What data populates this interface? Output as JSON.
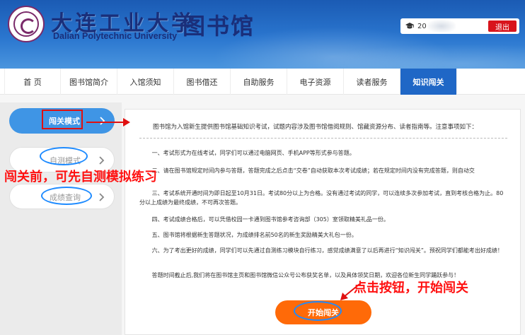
{
  "header": {
    "school_name_cn": "大连工业大学",
    "school_name_en": "Dalian Polytechnic University",
    "library_title": "图书馆",
    "user_id": "20",
    "logout_label": "退出"
  },
  "nav": {
    "items": [
      {
        "label": "首 页"
      },
      {
        "label": "图书馆简介"
      },
      {
        "label": "入馆须知"
      },
      {
        "label": "图书借还"
      },
      {
        "label": "自助服务"
      },
      {
        "label": "电子资源"
      },
      {
        "label": "读者服务"
      },
      {
        "label": "知识闯关"
      }
    ],
    "active": "知识闯关"
  },
  "sidebar": {
    "items": [
      {
        "label": "闯关模式"
      },
      {
        "label": "自测模式"
      },
      {
        "label": "成绩查询"
      }
    ]
  },
  "content": {
    "intro": "图书馆为入馆新生提供图书馆基础知识考试，试题内容涉及图书馆借阅规则、馆藏资源分布、读者指南等。注意事项如下：",
    "rules": [
      "一、考试形式为在线考试，同学们可以通过电脑网页、手机APP等形式参与答题。",
      "二、请在图书馆规定时间内参与答题，答题完成之后点击“交卷”自动获取本次考试成绩；若在规定时间内没有完成答题，则自动交",
      "三、考试系统开通时间为即日起至10月31日。考试80分以上为合格。没有通过考试的同学，可以连续多次参加考试，直到考核合格为止。80分以上成绩为最终成绩，不可再次答题。",
      "四、考试成绩合格后，可以凭借校园一卡通到图书馆参考咨询部（305）室领取精美礼品一份。",
      "五、图书馆将根据新生答题状况，为成绩排名前50名的新生奖励精美大礼包一份。",
      "六、为了考出更好的成绩，同学们可以先通过自测练习模块自行练习，感觉成绩满意了以后再进行“知识闯关”。预祝同学们都能考出好成绩！",
      "答题时间截止后,我们将在图书馆主页和图书馆微信公众号公布获奖名单，以及具体领奖日期，欢迎各位新生同学踊跃参与！"
    ],
    "start_button": "开始闯关"
  },
  "annotations": {
    "left_note": "闯关前，可先自测模拟练习",
    "bottom_note": "点击按钮，开始闯关"
  },
  "colors": {
    "header_blue": "#2a76cf",
    "nav_active": "#1f67c6",
    "side_active": "#3f95e5",
    "start_button": "#ff6a08",
    "logout": "#d8141c",
    "annotation_red": "#ff1010",
    "annotation_blue": "#1e8bff"
  },
  "icons": {
    "user": "graduation-cap-icon",
    "side_arrow": "chevron-right-icon",
    "logo": "university-seal-icon"
  }
}
